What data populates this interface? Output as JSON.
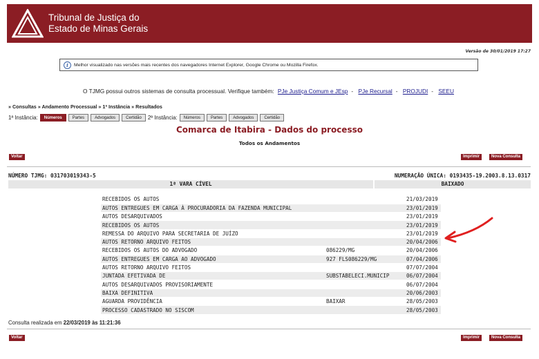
{
  "header": {
    "brand_line1": "Tribunal de Justiça do",
    "brand_line2": "Estado de Minas Gerais",
    "bg_color": "#8b1d24"
  },
  "version_text": "Versão de 30/01/2019 17:27",
  "notice": {
    "icon": "info-icon",
    "text": "Melhor visualizado nas versões mais recentes dos navegadores Internet Explorer, Google Chrome ou Mozilla Firefox."
  },
  "other_systems": {
    "intro": "O TJMG possui outros sistemas de consulta processual. Verifique também:",
    "links": [
      "PJe Justiça Comum e JEsp",
      "PJe Recursal",
      "PROJUDI",
      "SEEU"
    ],
    "separator": "-"
  },
  "breadcrumb": "» Consultas » Andamento Processual » 1ª Instância » Resultados",
  "tabs": {
    "first_label": "1ª Instância:",
    "first": [
      "Números",
      "Partes",
      "Advogados",
      "Certidão"
    ],
    "second_label": "2ª Instância:",
    "second": [
      "Números",
      "Partes",
      "Advogados",
      "Certidão"
    ]
  },
  "page_title": "Comarca de Itabira - Dados do processo",
  "subtitle": "Todos os Andamentos",
  "buttons": {
    "voltar": "Voltar",
    "imprimir": "Imprimir",
    "nova_consulta": "Nova Consulta"
  },
  "process": {
    "numero_tjmg": "NÚMERO TJMG: 031703019343-5",
    "numeracao_unica": "NUMERAÇÃO ÚNICA: 0193435-19.2003.8.13.0317",
    "vara": "1ª VARA CÍVEL",
    "status": "BAIXADO"
  },
  "andamentos": [
    {
      "desc": "RECEBIDOS OS AUTOS",
      "comp": "",
      "date": "21/03/2019"
    },
    {
      "desc": "AUTOS ENTREGUES EM CARGA À PROCURADORIA DA FAZENDA MUNICIPAL",
      "comp": "",
      "date": "23/01/2019"
    },
    {
      "desc": "AUTOS DESARQUIVADOS",
      "comp": "",
      "date": "23/01/2019"
    },
    {
      "desc": "RECEBIDOS OS AUTOS",
      "comp": "",
      "date": "23/01/2019"
    },
    {
      "desc": "REMESSA DO ARQUIVO PARA SECRETARIA DE JUÍZO",
      "comp": "",
      "date": "23/01/2019"
    },
    {
      "desc": "AUTOS RETORNO ARQUIVO FEITOS",
      "comp": "",
      "date": "20/04/2006"
    },
    {
      "desc": "RECEBIDOS OS AUTOS DO ADVOGADO",
      "comp": "086229/MG",
      "date": "20/04/2006"
    },
    {
      "desc": "AUTOS ENTREGUES EM CARGA AO ADVOGADO",
      "comp": "927 FLS086229/MG",
      "date": "07/04/2006"
    },
    {
      "desc": "AUTOS RETORNO ARQUIVO FEITOS",
      "comp": "",
      "date": "07/07/2004"
    },
    {
      "desc": "JUNTADA EFETIVADA DE",
      "comp": "SUBSTABELECI.MUNICIP",
      "date": "06/07/2004"
    },
    {
      "desc": "AUTOS DESARQUIVADOS PROVISORIAMENTE",
      "comp": "",
      "date": "06/07/2004"
    },
    {
      "desc": "BAIXA DEFINITIVA",
      "comp": "",
      "date": "20/06/2003"
    },
    {
      "desc": "AGUARDA PROVIDÊNCIA",
      "comp": "BAIXAR",
      "date": "28/05/2003"
    },
    {
      "desc": "PROCESSO CADASTRADO NO SISCOM",
      "comp": "",
      "date": "28/05/2003"
    }
  ],
  "consulta": {
    "prefix": "Consulta realizada em",
    "timestamp": "22/03/2019 às 11:21:36"
  }
}
